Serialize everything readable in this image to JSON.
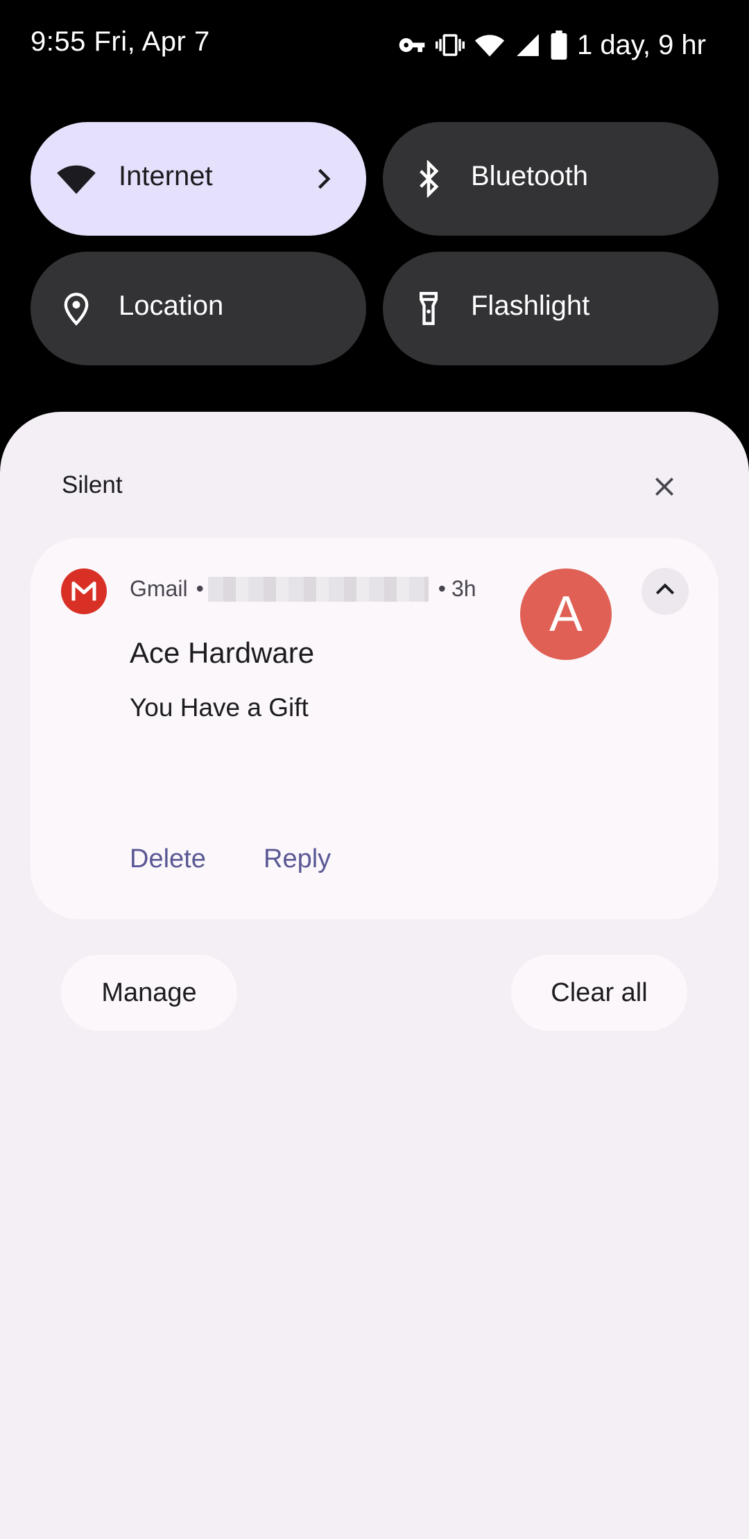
{
  "status_bar": {
    "time_date": "9:55 Fri, Apr 7",
    "battery_text": "1 day, 9 hr",
    "icons": [
      "vpn-key-icon",
      "vibrate-icon",
      "wifi-icon",
      "cell-signal-icon",
      "battery-icon"
    ]
  },
  "quick_settings": {
    "tiles": [
      {
        "label": "Internet",
        "icon": "wifi-icon",
        "active": true
      },
      {
        "label": "Bluetooth",
        "icon": "bluetooth-icon",
        "active": false
      },
      {
        "label": "Location",
        "icon": "location-pin-icon",
        "active": false
      },
      {
        "label": "Flashlight",
        "icon": "flashlight-icon",
        "active": false
      }
    ]
  },
  "notifications": {
    "section_title": "Silent",
    "card": {
      "app_name": "Gmail",
      "separator": "•",
      "time_ago": "3h",
      "avatar_letter": "A",
      "title": "Ace Hardware",
      "body": "You Have a Gift",
      "actions": [
        "Delete",
        "Reply"
      ]
    },
    "footer": {
      "manage_label": "Manage",
      "clear_all_label": "Clear all"
    }
  },
  "colors": {
    "accent_tile": "#e5e0fb",
    "tile_inactive": "#333235",
    "shade_bg": "#f3eff5",
    "action_text": "#5a5894",
    "gmail_red": "#d93025",
    "avatar_bg": "#e06055"
  }
}
